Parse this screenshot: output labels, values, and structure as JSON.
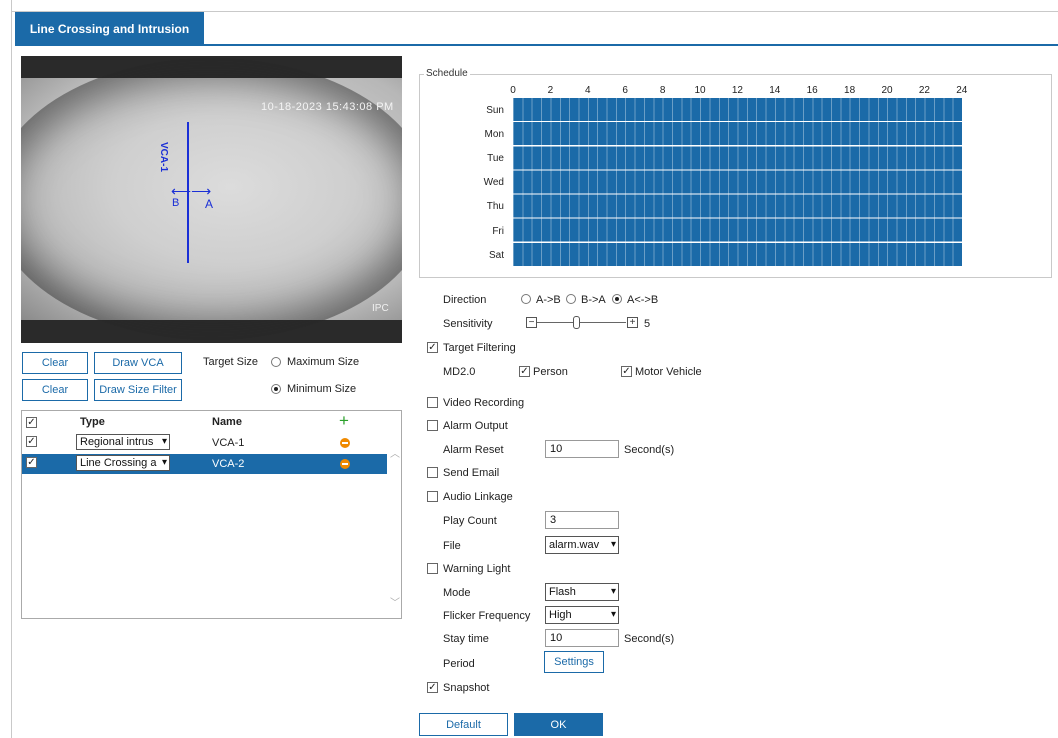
{
  "tab": {
    "label": "Line Crossing and Intrusion"
  },
  "video": {
    "timestamp": "10-18-2023 15:43:08 PM",
    "watermark": "IPC",
    "line_label": "VCA-1",
    "side_a": "A",
    "side_b": "B"
  },
  "controls": {
    "clear1": "Clear",
    "draw_vca": "Draw VCA",
    "clear2": "Clear",
    "draw_size_filter": "Draw Size Filter",
    "target_size_label": "Target Size",
    "max_size": "Maximum Size",
    "min_size": "Minimum Size",
    "selected_size": "Minimum Size"
  },
  "vca_table": {
    "headers": {
      "type": "Type",
      "name": "Name"
    },
    "rows": [
      {
        "checked": true,
        "type": "Regional intrus",
        "name": "VCA-1",
        "selected": false
      },
      {
        "checked": true,
        "type": "Line Crossing a",
        "name": "VCA-2",
        "selected": true
      }
    ]
  },
  "schedule": {
    "legend": "Schedule",
    "hours": [
      "0",
      "2",
      "4",
      "6",
      "8",
      "10",
      "12",
      "14",
      "16",
      "18",
      "20",
      "22",
      "24"
    ],
    "days": [
      "Sun",
      "Mon",
      "Tue",
      "Wed",
      "Thu",
      "Fri",
      "Sat"
    ]
  },
  "direction": {
    "label": "Direction",
    "options": [
      "A->B",
      "B->A",
      "A<->B"
    ],
    "selected": "A<->B"
  },
  "sensitivity": {
    "label": "Sensitivity",
    "value": "5",
    "level_fraction": 0.5
  },
  "target_filtering": {
    "label": "Target Filtering",
    "checked": true,
    "md_label": "MD2.0",
    "person": "Person",
    "motor_vehicle": "Motor Vehicle"
  },
  "video_recording": {
    "label": "Video Recording",
    "checked": false
  },
  "alarm_output": {
    "label": "Alarm Output",
    "checked": false
  },
  "alarm_reset": {
    "label": "Alarm Reset",
    "value": "10",
    "unit": "Second(s)"
  },
  "send_email": {
    "label": "Send Email",
    "checked": false
  },
  "audio_linkage": {
    "label": "Audio Linkage",
    "checked": false
  },
  "play_count": {
    "label": "Play Count",
    "value": "3"
  },
  "file": {
    "label": "File",
    "value": "alarm.wav"
  },
  "warning_light": {
    "label": "Warning Light",
    "checked": false
  },
  "mode": {
    "label": "Mode",
    "value": "Flash"
  },
  "flicker": {
    "label": "Flicker Frequency",
    "value": "High"
  },
  "stay_time": {
    "label": "Stay time",
    "value": "10",
    "unit": "Second(s)"
  },
  "period": {
    "label": "Period",
    "button": "Settings"
  },
  "snapshot": {
    "label": "Snapshot",
    "checked": true
  },
  "footer": {
    "default": "Default",
    "ok": "OK"
  },
  "colors": {
    "accent": "#1b6aa8",
    "delete": "#f08a00",
    "add": "#2ba02b"
  }
}
